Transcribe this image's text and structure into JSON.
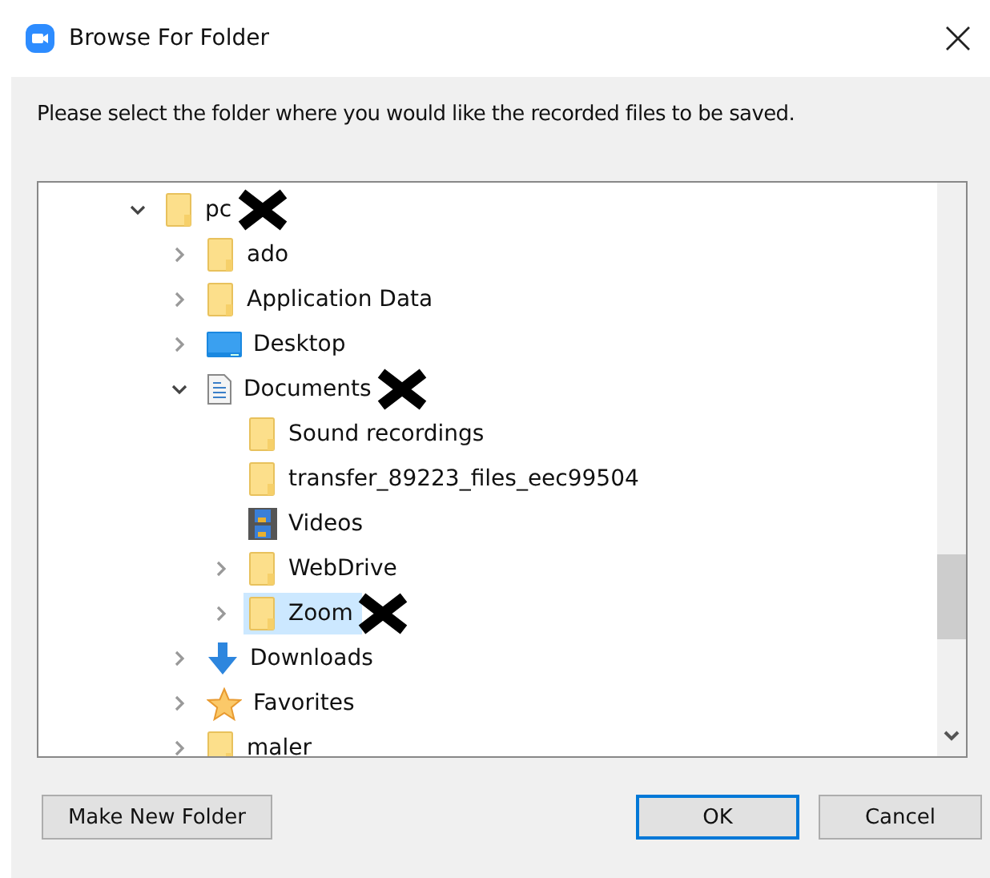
{
  "window": {
    "title": "Browse For Folder"
  },
  "instruction": "Please select the folder where you would like the recorded files to be saved.",
  "tree": [
    {
      "label": "pc",
      "kind": "folder",
      "expandable": true,
      "expanded": true,
      "selected": false,
      "redacted": true,
      "children": [
        {
          "label": "ado",
          "kind": "folder",
          "expandable": true,
          "expanded": false,
          "selected": false,
          "redacted": false
        },
        {
          "label": "Application Data",
          "kind": "folder",
          "expandable": true,
          "expanded": false,
          "selected": false,
          "redacted": false
        },
        {
          "label": "Desktop",
          "kind": "desktop",
          "expandable": true,
          "expanded": false,
          "selected": false,
          "redacted": false
        },
        {
          "label": "Documents",
          "kind": "documents",
          "expandable": true,
          "expanded": true,
          "selected": false,
          "redacted": true,
          "children": [
            {
              "label": "Sound recordings",
              "kind": "folder",
              "expandable": false,
              "selected": false,
              "redacted": false
            },
            {
              "label": "transfer_89223_files_eec99504",
              "kind": "folder",
              "expandable": false,
              "selected": false,
              "redacted": false
            },
            {
              "label": "Videos",
              "kind": "video",
              "expandable": false,
              "selected": false,
              "redacted": false
            },
            {
              "label": "WebDrive",
              "kind": "folder",
              "expandable": true,
              "expanded": false,
              "selected": false,
              "redacted": false
            },
            {
              "label": "Zoom",
              "kind": "folder",
              "expandable": true,
              "expanded": false,
              "selected": true,
              "redacted": true
            }
          ]
        },
        {
          "label": "Downloads",
          "kind": "download",
          "expandable": true,
          "expanded": false,
          "selected": false,
          "redacted": false
        },
        {
          "label": "Favorites",
          "kind": "favorites",
          "expandable": true,
          "expanded": false,
          "selected": false,
          "redacted": false
        },
        {
          "label": "maler",
          "kind": "folder",
          "expandable": true,
          "expanded": false,
          "selected": false,
          "redacted": false
        }
      ]
    }
  ],
  "buttons": [
    {
      "label": "Make New Folder",
      "kind": "left",
      "default": false
    },
    {
      "label": "OK",
      "kind": "right",
      "default": true
    },
    {
      "label": "Cancel",
      "kind": "right",
      "default": false
    }
  ]
}
